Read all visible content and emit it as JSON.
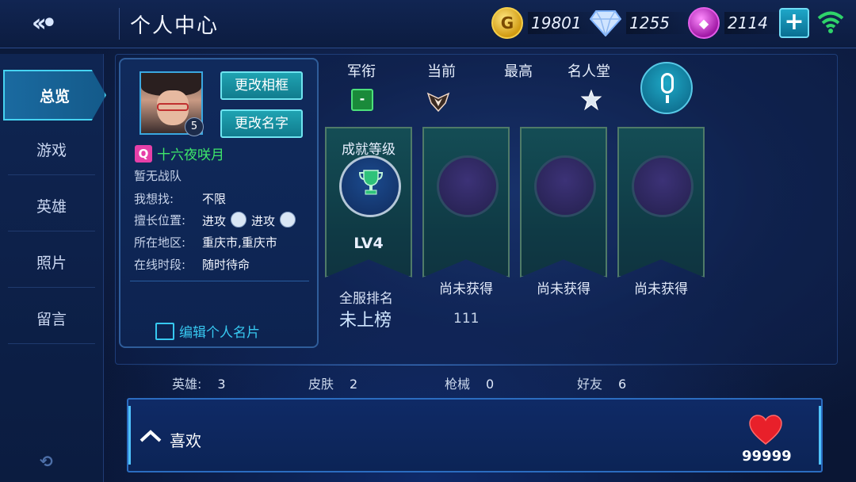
{
  "header": {
    "title": "个人中心",
    "gold": "19801",
    "diamond": "1255",
    "gem": "2114"
  },
  "sidebar": {
    "items": [
      {
        "label": "总览"
      },
      {
        "label": "游戏"
      },
      {
        "label": "英雄"
      },
      {
        "label": "照片"
      },
      {
        "label": "留言"
      }
    ]
  },
  "profile": {
    "level": "5",
    "change_frame": "更改相框",
    "change_name": "更改名字",
    "name": "十六夜咲月",
    "team": "暂无战队",
    "looking_for_label": "我想找:",
    "looking_for": "不限",
    "position_label": "擅长位置:",
    "position_1": "进攻",
    "position_2": "进攻",
    "region_label": "所在地区:",
    "region": "重庆市,重庆市",
    "online_label": "在线时段:",
    "online": "随时待命",
    "edit_card": "编辑个人名片"
  },
  "ranks": {
    "title_label": "军衔",
    "current_label": "当前",
    "highest_label": "最高",
    "hall_label": "名人堂",
    "title_badge": "-"
  },
  "achievements": {
    "title": "成就等级",
    "level": "LV4",
    "locked_1": "尚未获得",
    "locked_2": "尚未获得",
    "locked_3": "尚未获得",
    "server_rank_label": "全服排名",
    "server_rank_value": "未上榜",
    "extra_value": "111"
  },
  "stats": {
    "heroes_label": "英雄:",
    "heroes": "3",
    "skins_label": "皮肤",
    "skins": "2",
    "guns_label": "枪械",
    "guns": "0",
    "friends_label": "好友",
    "friends": "6"
  },
  "likes": {
    "label": "喜欢",
    "count": "99999"
  },
  "colors": {
    "accent": "#46d3f2",
    "name_green": "#3ee86a",
    "link_blue": "#37c8f0"
  }
}
